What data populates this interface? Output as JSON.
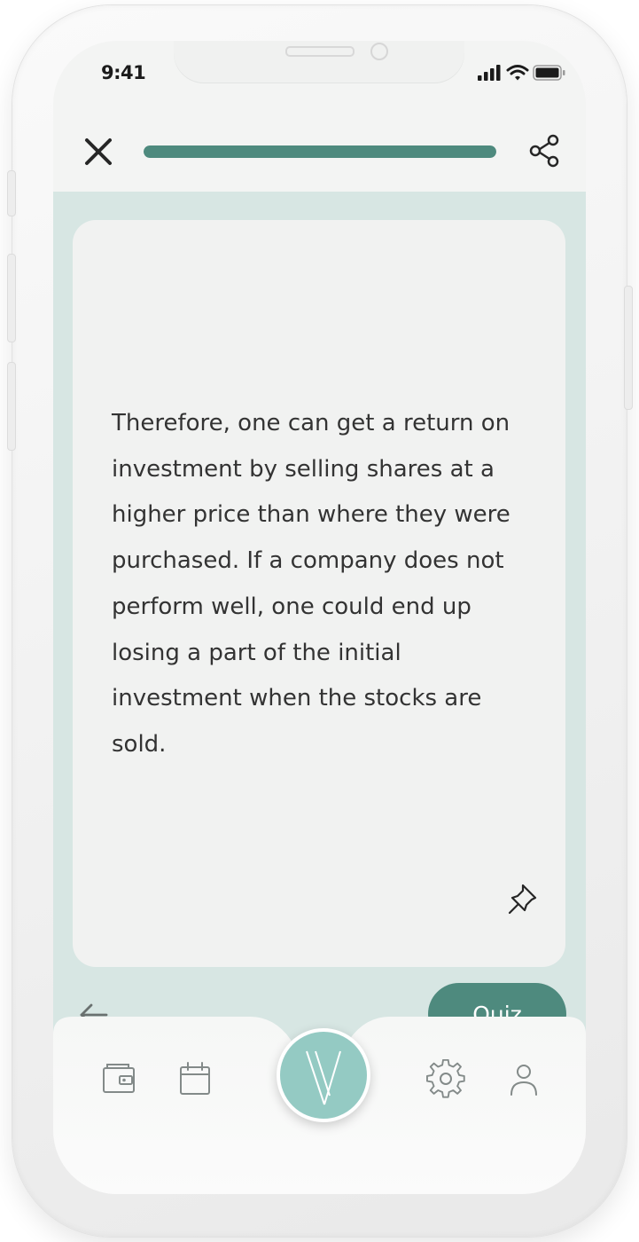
{
  "status": {
    "time": "9:41",
    "icons": [
      "signal-icon",
      "wifi-icon",
      "battery-icon"
    ]
  },
  "topbar": {
    "close_icon": "close-icon",
    "progress": 1.0,
    "share_icon": "share-icon"
  },
  "card": {
    "text": "Therefore, one can get a return on investment by selling shares at a higher price than where they were purchased. If a company does not perform well, one could end up losing a part of the initial investment when the stocks are sold.",
    "pin_icon": "pin-icon"
  },
  "nav": {
    "back_icon": "arrow-left-icon",
    "quiz_label": "Quiz"
  },
  "tabbar": {
    "items": [
      "wallet-icon",
      "calendar-icon",
      "app-logo",
      "settings-icon",
      "profile-icon"
    ]
  },
  "colors": {
    "accent": "#4e8a7e",
    "content_background": "#d7e6e3",
    "card_background": "#f1f2f1",
    "logo_background": "#94cac3"
  }
}
